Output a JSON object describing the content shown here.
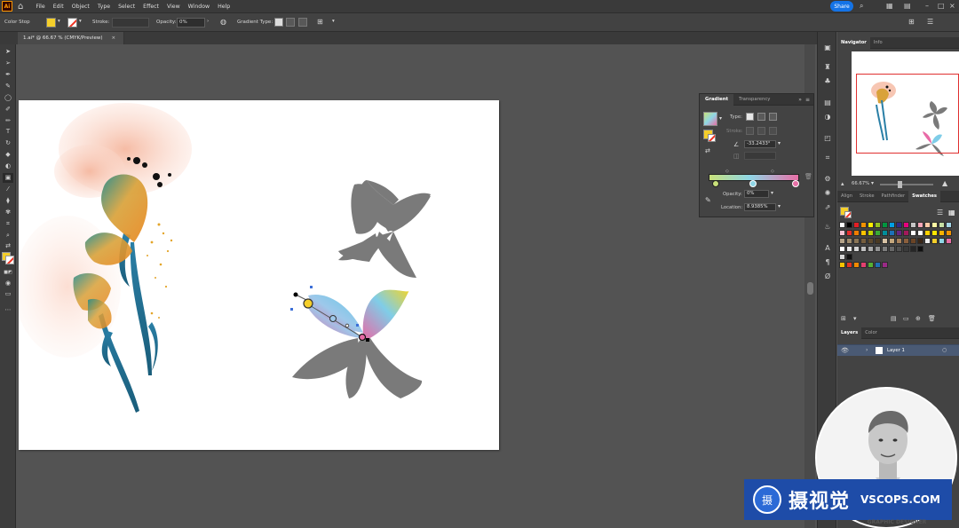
{
  "app": {
    "logo": "Ai",
    "menus": [
      "File",
      "Edit",
      "Object",
      "Type",
      "Select",
      "Effect",
      "View",
      "Window",
      "Help"
    ],
    "share_label": "Share"
  },
  "controlbar": {
    "mode_label": "Color Stop",
    "stroke_label": "Stroke:",
    "opacity_label": "Opacity:",
    "opacity_value": "0%",
    "gradient_type_label": "Gradient Type:"
  },
  "document": {
    "tab_title": "1.ai* @ 66.67 % (CMYK/Preview)",
    "close_glyph": "×"
  },
  "gradient_panel": {
    "tabs": [
      "Gradient",
      "Transparency"
    ],
    "type_label": "Type:",
    "stroke_label": "Stroke:",
    "angle_value": "-33.2433°",
    "opacity_label": "Opacity:",
    "opacity_value": "0%",
    "location_label": "Location:",
    "location_value": "8.9385%",
    "stop_colors": [
      "#c9e17a",
      "#8fd6e6",
      "#e86fa6"
    ]
  },
  "navigator": {
    "tabs": [
      "Navigator",
      "Info"
    ],
    "zoom_value": "66.67%"
  },
  "swatches_panel": {
    "tabs": [
      "Align",
      "Stroke",
      "Pathfinder",
      "Swatches"
    ]
  },
  "layers_panel": {
    "tabs": [
      "Layers",
      "Color"
    ],
    "layer_name": "Layer 1"
  },
  "overlay": {
    "brand_cn": "摄视觉",
    "brand_en": "VSCOPS.COM",
    "brand_mark": "摄",
    "caption": "GRAPHIC DESIGNER"
  },
  "colors": {
    "fill": "#f5cf2a",
    "artwork_gray": "#7a7a7a",
    "accent_blue": "#1473e6"
  }
}
